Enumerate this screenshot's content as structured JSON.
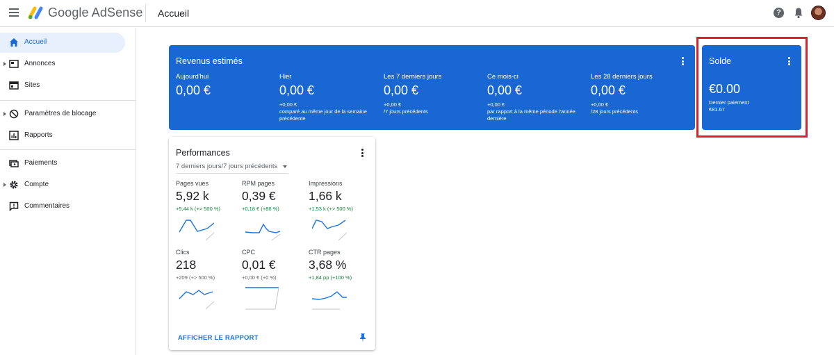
{
  "header": {
    "brand": "Google AdSense",
    "page_title": "Accueil"
  },
  "sidebar": {
    "items": [
      {
        "label": "Accueil",
        "icon": "home-icon"
      },
      {
        "label": "Annonces",
        "icon": "ads-icon"
      },
      {
        "label": "Sites",
        "icon": "sites-icon"
      },
      {
        "label": "Paramètres de blocage",
        "icon": "block-icon"
      },
      {
        "label": "Rapports",
        "icon": "reports-icon"
      },
      {
        "label": "Paiements",
        "icon": "payments-icon"
      },
      {
        "label": "Compte",
        "icon": "gear-icon"
      },
      {
        "label": "Commentaires",
        "icon": "feedback-icon"
      }
    ]
  },
  "revenue": {
    "title": "Revenus estimés",
    "columns": [
      {
        "label": "Aujourd'hui",
        "value": "0,00 €",
        "delta": "",
        "comparison": ""
      },
      {
        "label": "Hier",
        "value": "0,00 €",
        "delta": "+0,00 €",
        "comparison": "comparé au même jour de la semaine précédente"
      },
      {
        "label": "Les 7 derniers jours",
        "value": "0,00 €",
        "delta": "+0,00 €",
        "comparison": "/7 jours précédents"
      },
      {
        "label": "Ce mois-ci",
        "value": "0,00 €",
        "delta": "+0,00 €",
        "comparison": "par rapport à la même période l'année dernière"
      },
      {
        "label": "Les 28 derniers jours",
        "value": "0,00 €",
        "delta": "+0,00 €",
        "comparison": "/28 jours précédents"
      }
    ]
  },
  "balance": {
    "title": "Solde",
    "value": "€0.00",
    "last_payment_label": "Dernier paiement",
    "last_payment_value": "€81.67"
  },
  "performance": {
    "title": "Performances",
    "period": "7 derniers jours/7 jours précédents",
    "metrics": [
      {
        "label": "Pages vues",
        "value": "5,92 k",
        "delta": "+5,44 k (+> 500 %)"
      },
      {
        "label": "RPM pages",
        "value": "0,39 €",
        "delta": "+0,18 € (+86 %)"
      },
      {
        "label": "Impressions",
        "value": "1,66 k",
        "delta": "+1,53 k (+> 500 %)"
      },
      {
        "label": "Clics",
        "value": "218",
        "delta": "+209 (+> 500 %)"
      },
      {
        "label": "CPC",
        "value": "0,01 €",
        "delta": "+0,00 € (+0 %)"
      },
      {
        "label": "CTR pages",
        "value": "3,68 %",
        "delta": "+1,84 pp (+100 %)"
      }
    ],
    "report_link": "AFFICHER LE RAPPORT"
  },
  "colors": {
    "accent": "#1967d2",
    "positive": "#188038",
    "highlight": "#d8232a"
  }
}
